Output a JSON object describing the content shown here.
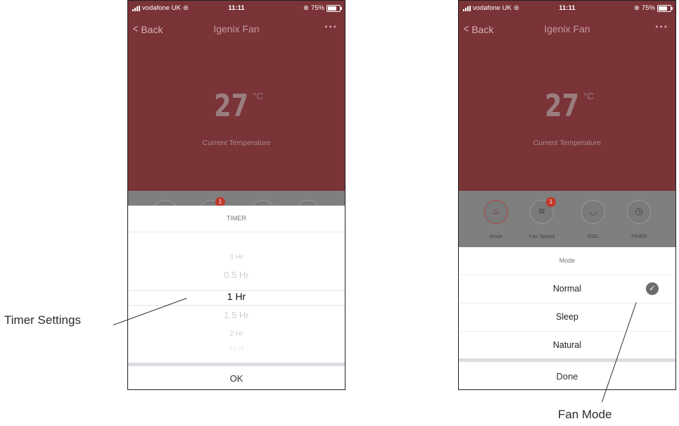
{
  "status_bar": {
    "carrier": "vodafone UK",
    "time": "11:11",
    "battery": "75%"
  },
  "nav": {
    "back_label": "Back",
    "title": "Igenix Fan",
    "more": "•••"
  },
  "temperature": {
    "value": "27",
    "unit": "°C",
    "label": "Current Temperature"
  },
  "controls": [
    {
      "label": "Mode",
      "icon": "heat-mode-icon"
    },
    {
      "label": "Fan Speed",
      "icon": "fan-speed-icon",
      "badge": "1"
    },
    {
      "label": "OSC",
      "icon": "oscillate-icon"
    },
    {
      "label": "TIMER",
      "icon": "clock-icon"
    }
  ],
  "timer_sheet": {
    "title": "TIMER",
    "options": [
      "0 Hr",
      "0.5 Hr",
      "1 Hr",
      "1.5 Hr",
      "2 Hr",
      "2.5 Hr"
    ],
    "selected": "1 Hr",
    "ok_label": "OK"
  },
  "mode_sheet": {
    "title": "Mode",
    "options": [
      "Normal",
      "Sleep",
      "Natural"
    ],
    "selected": "Normal",
    "done_label": "Done"
  },
  "annotations": {
    "left": "Timer Settings",
    "right": "Fan Mode"
  }
}
